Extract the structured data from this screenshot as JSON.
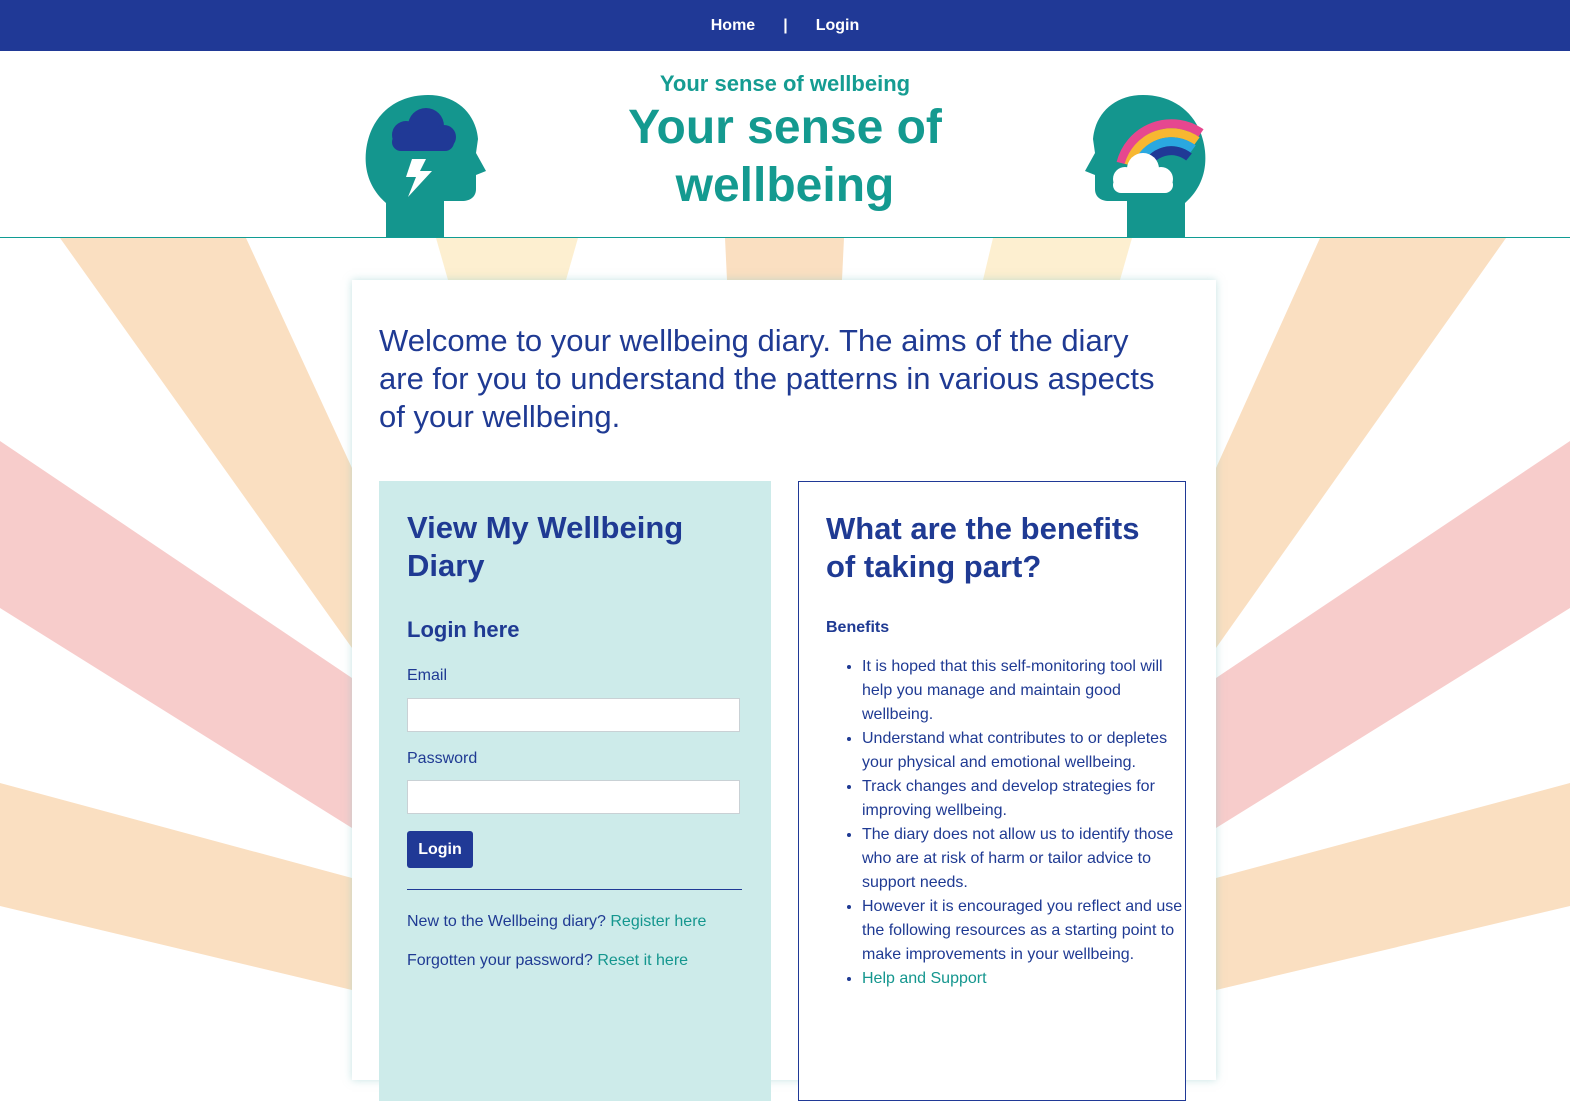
{
  "nav": {
    "home": "Home",
    "separator": "|",
    "login": "Login"
  },
  "banner": {
    "subtitle": "Your sense of wellbeing",
    "title": "Your sense of wellbeing"
  },
  "intro": "Welcome to your wellbeing diary. The aims of the diary are for you to understand the patterns in various aspects of your wellbeing.",
  "login_panel": {
    "heading": "View My Wellbeing Diary",
    "subheading": "Login here",
    "email_label": "Email",
    "email_value": "",
    "password_label": "Password",
    "password_value": "",
    "login_button": "Login",
    "register_prompt": "New to the Wellbeing diary?",
    "register_link": "Register here",
    "reset_prompt": "Forgotten your password?",
    "reset_link": "Reset it here"
  },
  "benefits_panel": {
    "heading": "What are the benefits of taking part?",
    "subheading": "Benefits",
    "items": [
      "It is hoped that this self-monitoring tool will help you manage and maintain good wellbeing.",
      "Understand what contributes to or depletes your physical and emotional wellbeing.",
      "Track changes and develop strategies for improving wellbeing.",
      "The diary does not allow us to identify those who are at risk of harm or tailor advice to support needs.",
      "However it is encouraged you reflect and use the following resources as a starting point to make improvements in your wellbeing."
    ],
    "link": "Help and Support"
  },
  "colors": {
    "nav_bg": "#203996",
    "teal": "#149a90",
    "navy_text": "#1f3a93",
    "panel_bg": "#cdebea",
    "ray_peach": "#fadfc1",
    "ray_pink": "#f7cccb",
    "ray_yellow": "#fdefd0"
  },
  "icons": [
    "head-storm-cloud-icon",
    "head-rainbow-icon"
  ]
}
